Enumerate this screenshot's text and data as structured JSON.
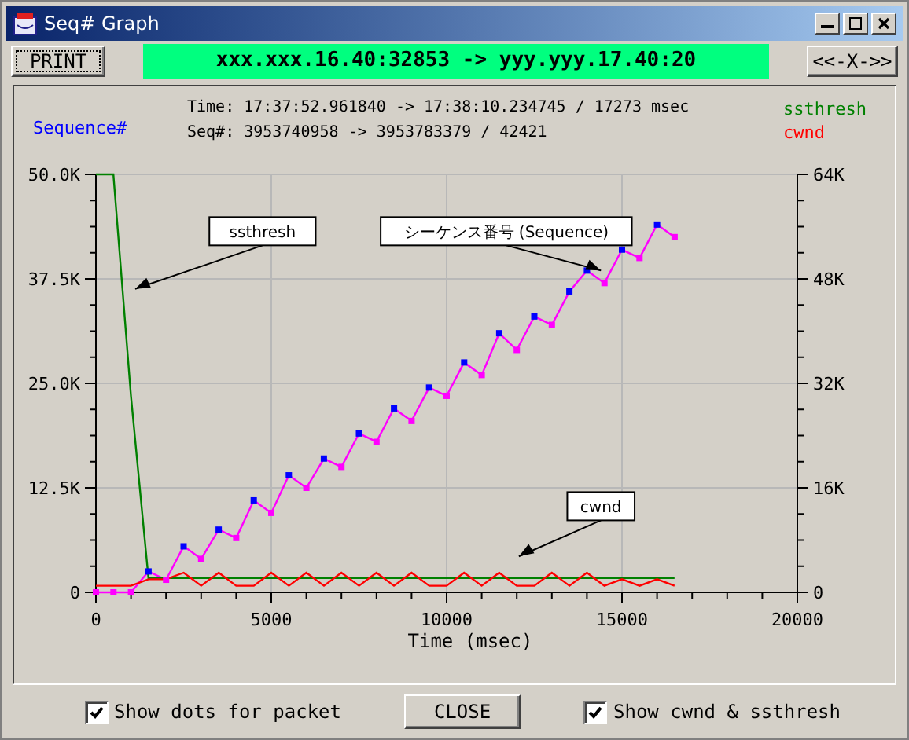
{
  "window": {
    "title": "Seq# Graph"
  },
  "toolbar": {
    "print_button": "PRINT",
    "connection": "xxx.xxx.16.40:32853 -> yyy.yyy.17.40:20",
    "swap_button": "<<-X->>"
  },
  "info": {
    "time_line": "Time: 17:37:52.961840 -> 17:38:10.234745 / 17273 msec",
    "seq_line": "Seq#: 3953740958 -> 3953783379 / 42421"
  },
  "chart": {
    "chart_data": {
      "type": "line",
      "xlabel": "Time (msec)",
      "x": [
        0,
        500,
        1000,
        1500,
        2000,
        2500,
        3000,
        3500,
        4000,
        4500,
        5000,
        5500,
        6000,
        6500,
        7000,
        7500,
        8000,
        8500,
        9000,
        9500,
        10000,
        10500,
        11000,
        11500,
        12000,
        12500,
        13000,
        13500,
        14000,
        14500,
        15000,
        15500,
        16000,
        16500
      ],
      "series": [
        {
          "name": "Sequence#",
          "color": "#ff00ff",
          "marker": "square",
          "values": [
            0,
            0,
            0,
            2500,
            1500,
            5500,
            4000,
            7500,
            6500,
            11000,
            9500,
            14000,
            12500,
            16000,
            15000,
            19000,
            18000,
            22000,
            20500,
            24500,
            23500,
            27500,
            26000,
            31000,
            29000,
            33000,
            32000,
            36000,
            38500,
            37000,
            41000,
            40000,
            44000,
            42500
          ]
        },
        {
          "name": "ssthresh",
          "color": "#008000",
          "axis": "y2",
          "values": [
            64000,
            64000,
            30000,
            2200,
            2200,
            2200,
            2200,
            2200,
            2200,
            2200,
            2200,
            2200,
            2200,
            2200,
            2200,
            2200,
            2200,
            2200,
            2200,
            2200,
            2200,
            2200,
            2200,
            2200,
            2200,
            2200,
            2200,
            2200,
            2200,
            2200,
            2200,
            2200,
            2200,
            2200
          ]
        },
        {
          "name": "cwnd",
          "color": "#ff0000",
          "axis": "y2",
          "values": [
            1000,
            1000,
            1000,
            2000,
            2000,
            3000,
            1000,
            3000,
            1000,
            1000,
            3000,
            1000,
            3000,
            1000,
            3000,
            1000,
            3000,
            1000,
            3000,
            1000,
            1000,
            3000,
            1000,
            3000,
            1000,
            1000,
            3000,
            1000,
            3000,
            1000,
            2000,
            1000,
            2000,
            1000
          ]
        }
      ],
      "grid": true,
      "xlim": [
        0,
        20000
      ],
      "ylim": [
        0,
        50000
      ],
      "xticks": [
        0,
        5000,
        10000,
        15000,
        20000
      ],
      "yticks": [
        {
          "value": 0,
          "label": "0"
        },
        {
          "value": 12500,
          "label": "12.5K"
        },
        {
          "value": 25000,
          "label": "25.0K"
        },
        {
          "value": 37500,
          "label": "37.5K"
        },
        {
          "value": 50000,
          "label": "50.0K"
        }
      ],
      "y2lim": [
        0,
        64000
      ],
      "y2ticks": [
        {
          "value": 0,
          "label": "0"
        },
        {
          "value": 16000,
          "label": "16K"
        },
        {
          "value": 32000,
          "label": "32K"
        },
        {
          "value": 48000,
          "label": "48K"
        },
        {
          "value": 64000,
          "label": "64K"
        }
      ],
      "annotations": [
        "ssthresh",
        "シーケンス番号 (Sequence)",
        "cwnd"
      ]
    }
  },
  "footer": {
    "checkboxes": [
      {
        "label": "Show dots for packet",
        "checked": true
      },
      {
        "label": "Show cwnd & ssthresh",
        "checked": true
      }
    ],
    "close_button": "CLOSE"
  }
}
